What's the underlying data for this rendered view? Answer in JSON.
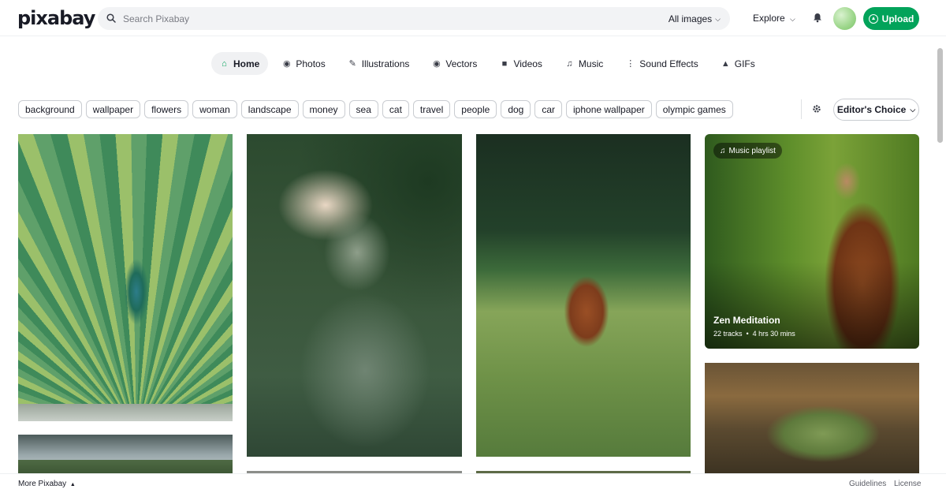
{
  "header": {
    "logo": "pixabay",
    "search_placeholder": "Search Pixabay",
    "search_value": "",
    "filter_label": "All images",
    "explore_label": "Explore",
    "upload_label": "Upload"
  },
  "tabs": [
    {
      "label": "Home",
      "icon": "home-icon",
      "active": true
    },
    {
      "label": "Photos",
      "icon": "camera-icon"
    },
    {
      "label": "Illustrations",
      "icon": "brush-icon"
    },
    {
      "label": "Vectors",
      "icon": "pen-nib-icon"
    },
    {
      "label": "Videos",
      "icon": "video-icon"
    },
    {
      "label": "Music",
      "icon": "music-note-icon"
    },
    {
      "label": "Sound Effects",
      "icon": "waveform-icon"
    },
    {
      "label": "GIFs",
      "icon": "flame-icon"
    }
  ],
  "tags": [
    "background",
    "wallpaper",
    "flowers",
    "woman",
    "landscape",
    "money",
    "sea",
    "cat",
    "travel",
    "people",
    "dog",
    "car",
    "iphone wallpaper",
    "olympic games"
  ],
  "sort_label": "Editor's Choice",
  "playlist": {
    "badge": "Music playlist",
    "title": "Zen Meditation",
    "tracks": "22 tracks",
    "duration": "4 hrs 30 mins"
  },
  "footer": {
    "more": "More Pixabay",
    "guidelines": "Guidelines",
    "license": "License"
  },
  "colors": {
    "brand_green": "#02a35a",
    "text": "#191b26"
  }
}
